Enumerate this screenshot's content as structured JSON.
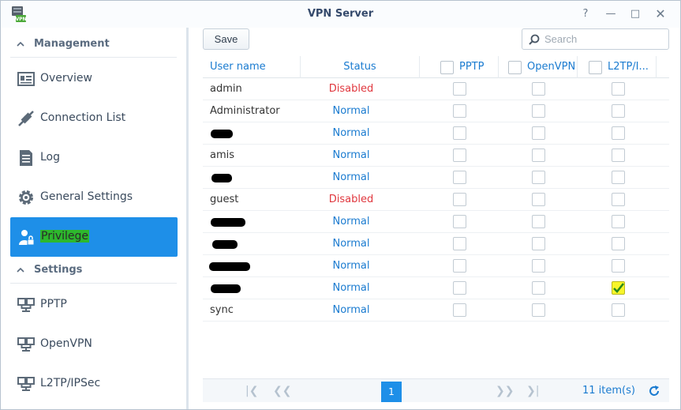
{
  "window": {
    "title": "VPN Server"
  },
  "sidebar": {
    "sections": [
      {
        "label": "Management",
        "items": [
          {
            "label": "Overview",
            "icon": "overview-icon"
          },
          {
            "label": "Connection List",
            "icon": "connection-icon"
          },
          {
            "label": "Log",
            "icon": "log-icon"
          },
          {
            "label": "General Settings",
            "icon": "gear-icon"
          },
          {
            "label": "Privilege",
            "icon": "user-lock-icon",
            "active": true
          }
        ]
      },
      {
        "label": "Settings",
        "items": [
          {
            "label": "PPTP",
            "icon": "network-icon"
          },
          {
            "label": "OpenVPN",
            "icon": "network-icon"
          },
          {
            "label": "L2TP/IPSec",
            "icon": "network-icon"
          }
        ]
      }
    ]
  },
  "toolbar": {
    "save_label": "Save",
    "search_placeholder": "Search"
  },
  "table": {
    "headers": {
      "user": "User name",
      "status": "Status",
      "pptp": "PPTP",
      "openvpn": "OpenVPN",
      "l2tp": "L2TP/I..."
    },
    "rows": [
      {
        "user": "admin",
        "status": "Disabled",
        "l2tp": false
      },
      {
        "user": "Administrator",
        "status": "Normal",
        "l2tp": false
      },
      {
        "user": "",
        "status": "Normal",
        "l2tp": false
      },
      {
        "user": "amis",
        "status": "Normal",
        "l2tp": false
      },
      {
        "user": "",
        "status": "Normal",
        "l2tp": false
      },
      {
        "user": "guest",
        "status": "Disabled",
        "l2tp": false
      },
      {
        "user": "",
        "status": "Normal",
        "l2tp": false
      },
      {
        "user": "",
        "status": "Normal",
        "l2tp": false
      },
      {
        "user": "",
        "status": "Normal",
        "l2tp": false
      },
      {
        "user": "",
        "status": "Normal",
        "l2tp": true
      },
      {
        "user": "sync",
        "status": "Normal",
        "l2tp": false
      }
    ]
  },
  "pager": {
    "page": "1",
    "items": "11 item(s)"
  },
  "colors": {
    "accent": "#1e8fe8",
    "normal": "#1a7bd0",
    "disabled": "#e0373e",
    "highlight": "#2db82d"
  }
}
